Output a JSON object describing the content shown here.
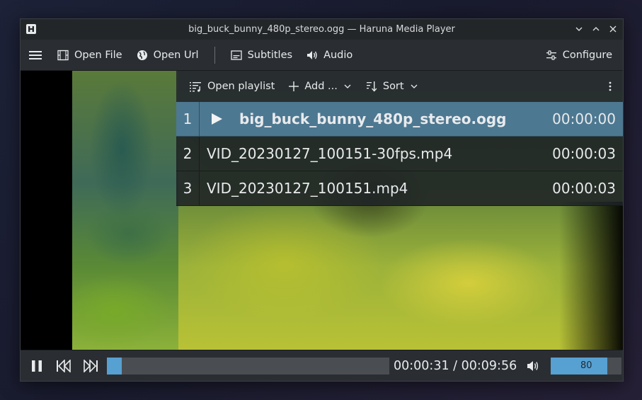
{
  "window": {
    "title": "big_buck_bunny_480p_stereo.ogg — Haruna Media Player"
  },
  "toolbar": {
    "open_file": "Open File",
    "open_url": "Open Url",
    "subtitles": "Subtitles",
    "audio": "Audio",
    "configure": "Configure"
  },
  "playlist": {
    "open_playlist": "Open playlist",
    "add": "Add ...",
    "sort": "Sort",
    "items": [
      {
        "index": "1",
        "name": "big_buck_bunny_480p_stereo.ogg",
        "duration": "00:00:00",
        "active": true
      },
      {
        "index": "2",
        "name": "VID_20230127_100151-30fps.mp4",
        "duration": "00:00:03",
        "active": false
      },
      {
        "index": "3",
        "name": "VID_20230127_100151.mp4",
        "duration": "00:00:03",
        "active": false
      }
    ]
  },
  "footer": {
    "timecode": "00:00:31 / 00:09:56",
    "progress": 0.052,
    "volume": 80,
    "volume_label": "80"
  },
  "colors": {
    "accent": "#57a0d2",
    "active_row": "#4d7891"
  }
}
